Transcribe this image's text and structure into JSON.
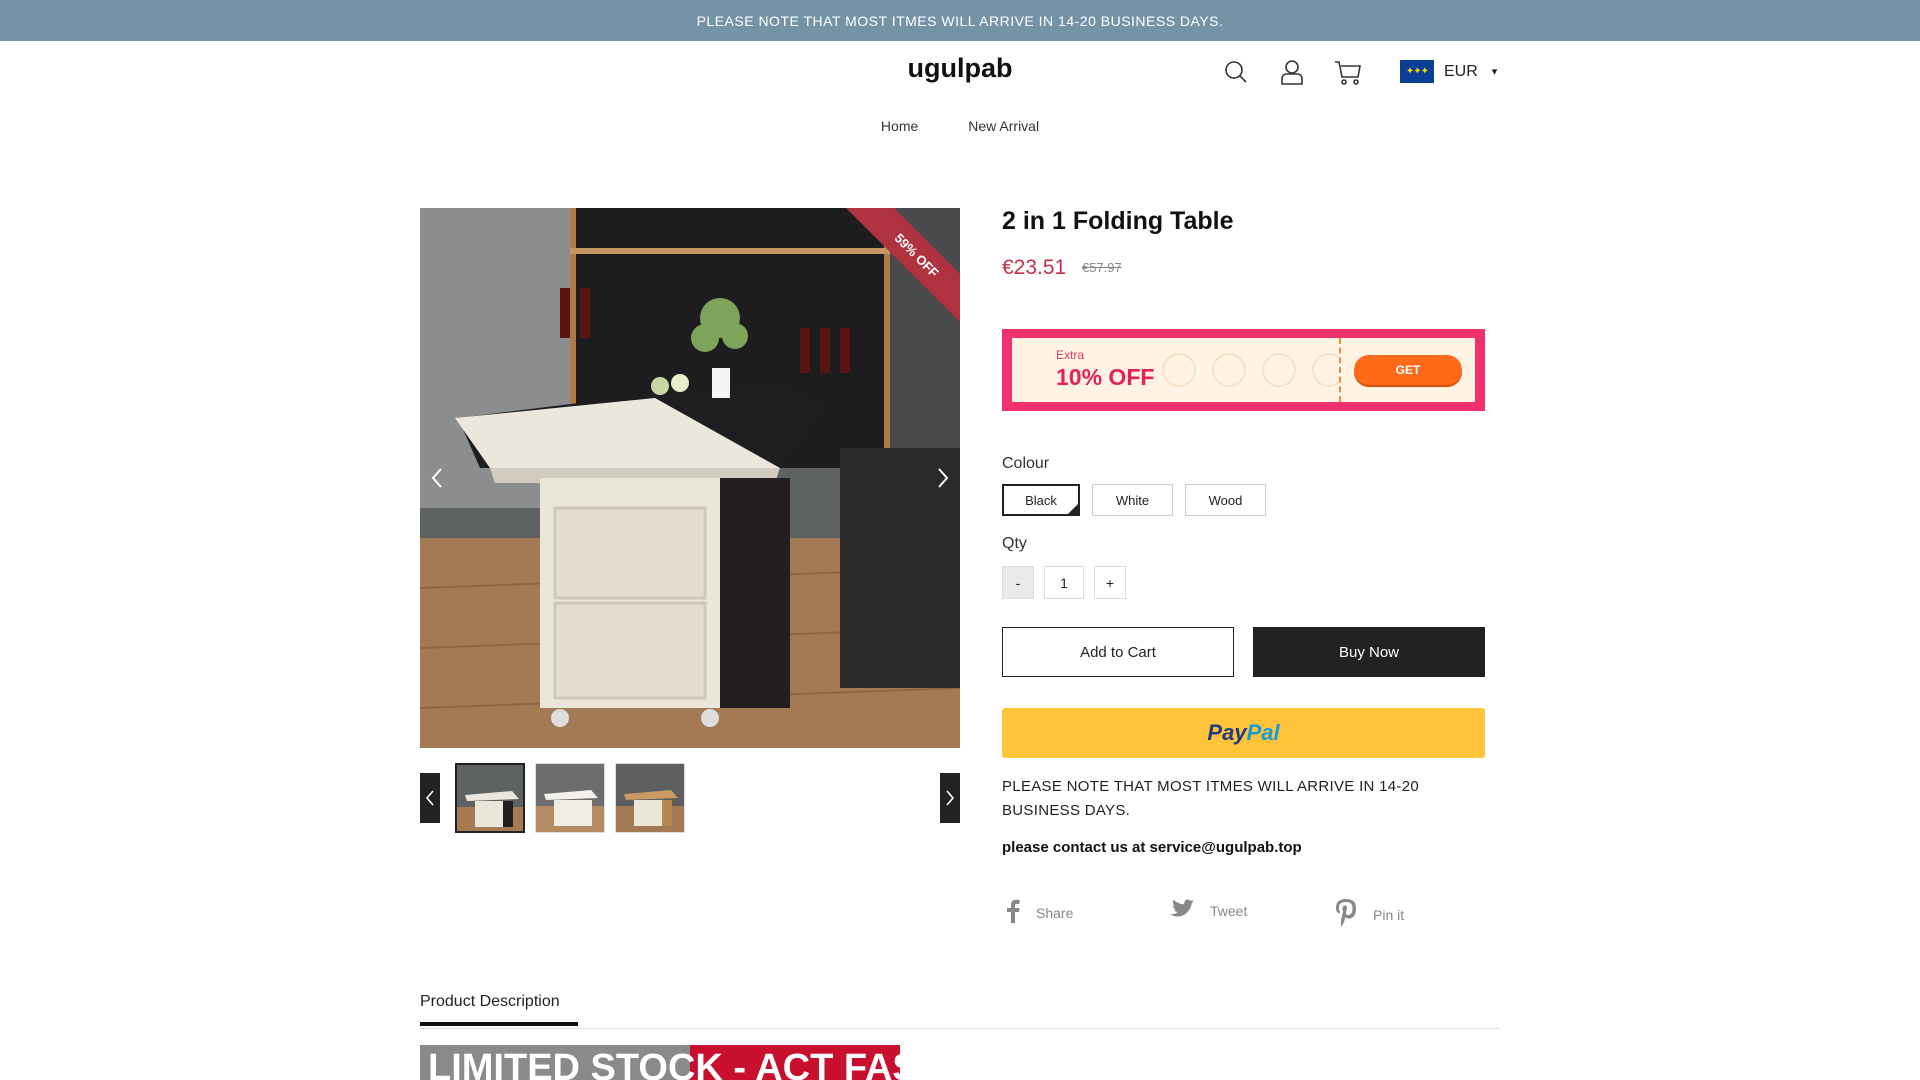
{
  "announcement": "PLEASE NOTE THAT MOST ITMES WILL ARRIVE IN 14-20 BUSINESS DAYS.",
  "header": {
    "logo": "ugulpab",
    "currency": "EUR",
    "icons": [
      "search-icon",
      "account-icon",
      "cart-icon"
    ]
  },
  "nav": {
    "items": [
      {
        "label": "Home"
      },
      {
        "label": "New Arrival"
      }
    ]
  },
  "gallery": {
    "ribbon": "59% OFF",
    "prev_arrow": "‹",
    "next_arrow": "›"
  },
  "product": {
    "title": "2 in 1 Folding Table",
    "price": "€23.51",
    "compare_price": "€57.97"
  },
  "coupon": {
    "extra": "Extra",
    "off": "10% OFF",
    "button": "GET"
  },
  "options": {
    "colour_label": "Colour",
    "colours": [
      "Black",
      "White",
      "Wood"
    ],
    "selected_colour": "Black",
    "qty_label": "Qty",
    "qty_minus": "-",
    "qty_value": "1",
    "qty_plus": "+"
  },
  "actions": {
    "add_to_cart": "Add to Cart",
    "buy_now": "Buy Now",
    "paypal_part1": "Pay",
    "paypal_part2": "Pal"
  },
  "notes": {
    "shipping": "PLEASE NOTE THAT MOST ITMES WILL ARRIVE IN 14-20 BUSINESS DAYS.",
    "contact": "please contact us at service@ugulpab.top"
  },
  "share": {
    "facebook": "Share",
    "twitter": "Tweet",
    "pinterest": "Pin it"
  },
  "description": {
    "tab": "Product Description",
    "banner": "LIMITED STOCK - ACT FAST!"
  },
  "colors": {
    "announcement_bg": "#7593a6",
    "price": "#c0304a",
    "coupon_bg": "#f0316c",
    "coupon_button": "#ff6a1a",
    "paypal": "#ffc439",
    "ribbon": "#b0313f"
  }
}
